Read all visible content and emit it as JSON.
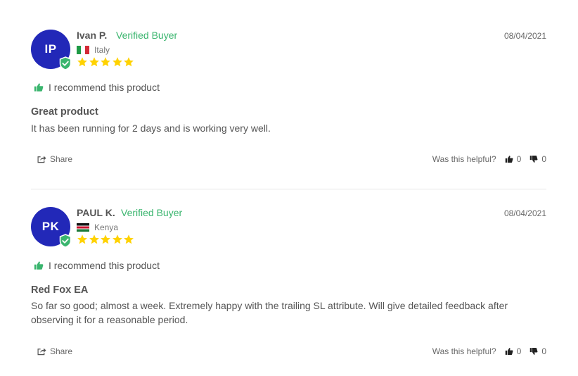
{
  "reviews": [
    {
      "initials": "IP",
      "name": "Ivan P.",
      "verified_label": "Verified Buyer",
      "country": "Italy",
      "flag": "italy-flag",
      "rating": 5,
      "date": "08/04/2021",
      "recommend_text": "I recommend this product",
      "title": "Great product",
      "body": "It has been running for 2 days and is working very well.",
      "share_label": "Share",
      "helpful_label": "Was this helpful?",
      "upvotes": "0",
      "downvotes": "0"
    },
    {
      "initials": "PK",
      "name": "PAUL K.",
      "verified_label": "Verified Buyer",
      "country": "Kenya",
      "flag": "kenya-flag",
      "rating": 5,
      "date": "08/04/2021",
      "recommend_text": "I recommend this product",
      "title": "Red Fox EA",
      "body": "So far so good; almost a week. Extremely happy with the trailing SL attribute. Will give detailed feedback after observing it for a reasonable period.",
      "share_label": "Share",
      "helpful_label": "Was this helpful?",
      "upvotes": "0",
      "downvotes": "0"
    }
  ],
  "colors": {
    "avatar": "#2228b8",
    "verified": "#3ab56e",
    "star": "#ffd200"
  }
}
